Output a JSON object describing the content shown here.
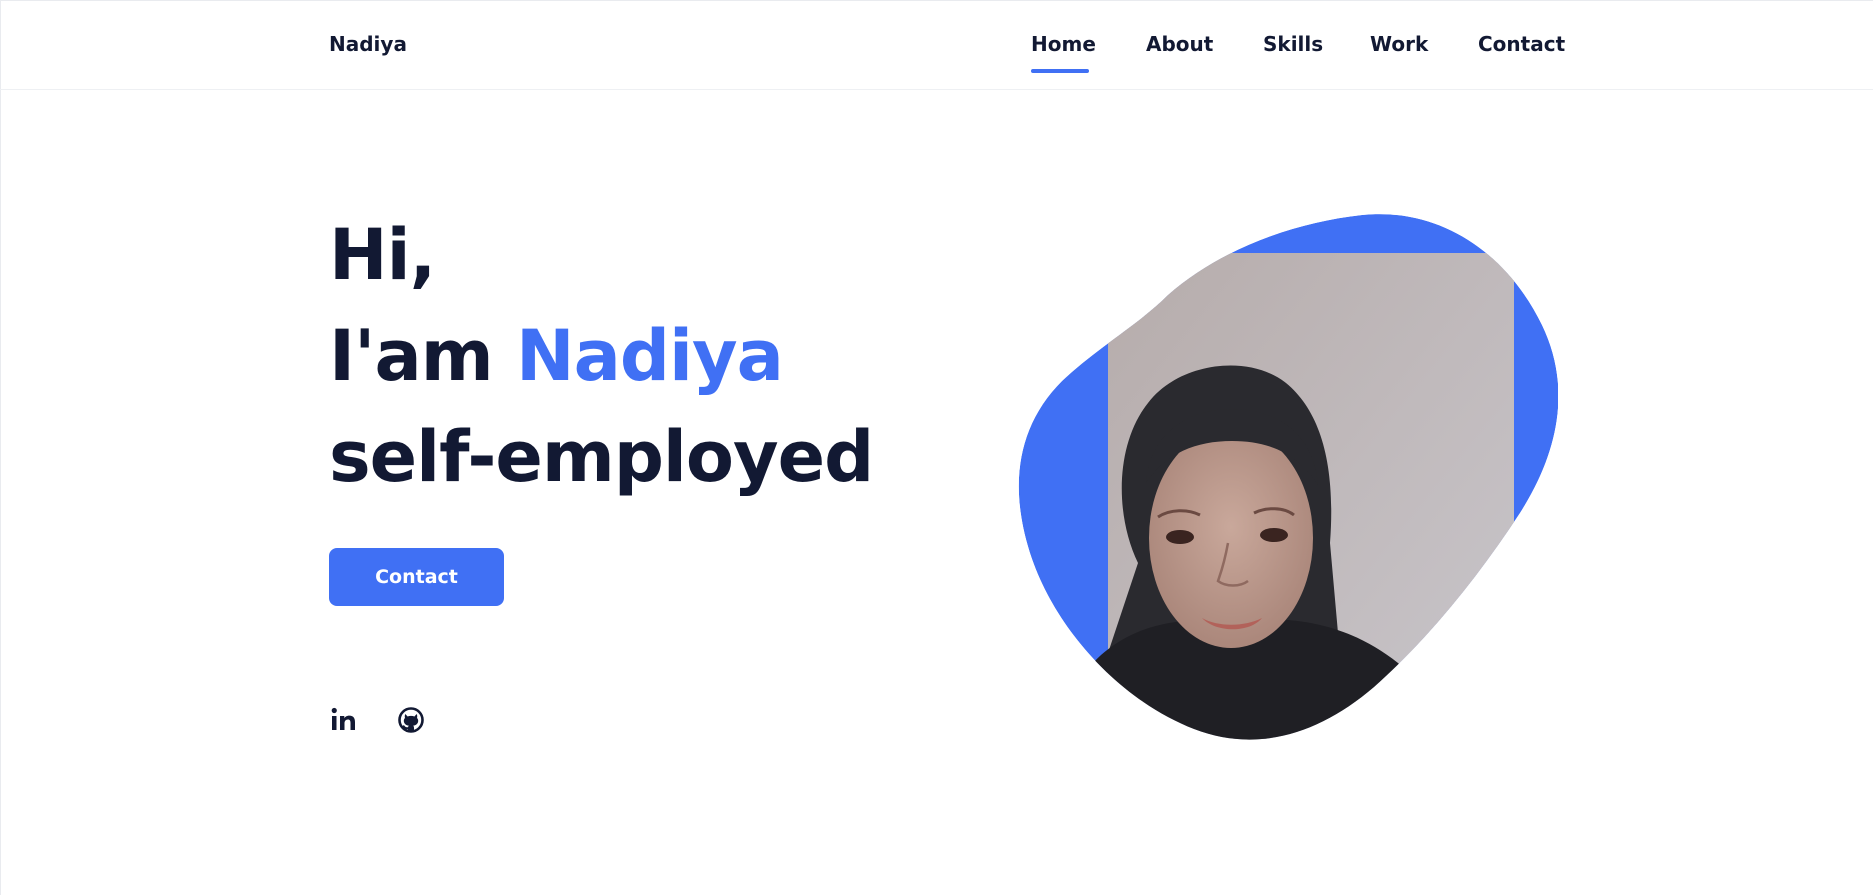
{
  "header": {
    "logo": "Nadiya",
    "nav": [
      {
        "label": "Home",
        "active": true
      },
      {
        "label": "About",
        "active": false
      },
      {
        "label": "Skills",
        "active": false
      },
      {
        "label": "Work",
        "active": false
      },
      {
        "label": "Contact",
        "active": false
      }
    ]
  },
  "hero": {
    "greeting": "Hi,",
    "intro_prefix": "I'am ",
    "name": "Nadiya",
    "role": "self-employed",
    "button_label": "Contact"
  },
  "social": {
    "icons": [
      "linkedin-icon",
      "github-icon"
    ]
  },
  "colors": {
    "accent": "#4070f4",
    "text": "#121933",
    "background": "#ffffff"
  }
}
